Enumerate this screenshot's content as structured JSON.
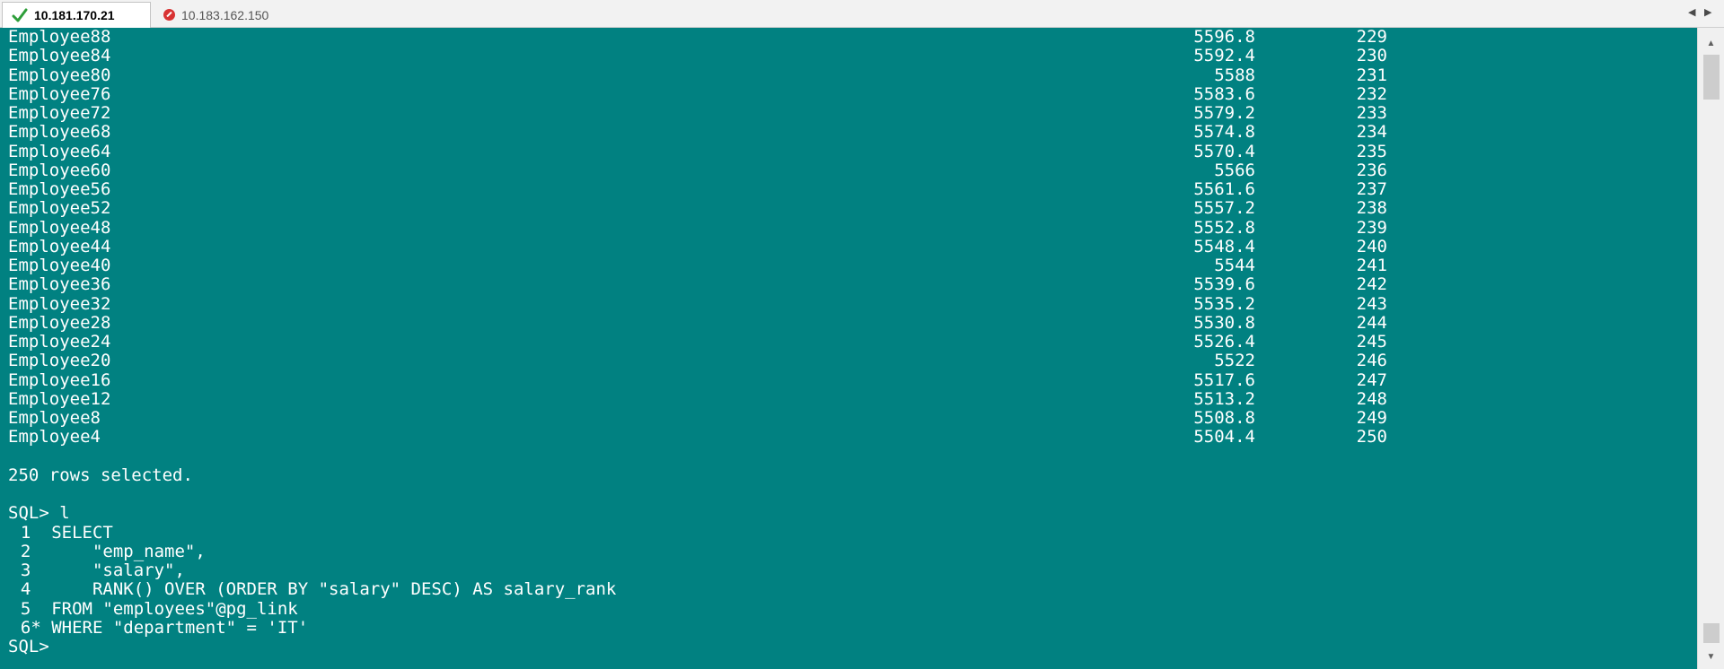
{
  "tabs": [
    {
      "label": "10.181.170.21",
      "status": "connected"
    },
    {
      "label": "10.183.162.150",
      "status": "disconnected"
    }
  ],
  "colors": {
    "terminal_bg": "#018181",
    "terminal_text": "#ffffff",
    "tab_bar": "#f2f2f2"
  },
  "icons": {
    "active_tab": "check-icon",
    "inactive_tab": "disconnected-icon"
  },
  "rows": [
    {
      "name": "Employee88",
      "salary": "5596.8",
      "rank": "229"
    },
    {
      "name": "Employee84",
      "salary": "5592.4",
      "rank": "230"
    },
    {
      "name": "Employee80",
      "salary": "5588",
      "rank": "231"
    },
    {
      "name": "Employee76",
      "salary": "5583.6",
      "rank": "232"
    },
    {
      "name": "Employee72",
      "salary": "5579.2",
      "rank": "233"
    },
    {
      "name": "Employee68",
      "salary": "5574.8",
      "rank": "234"
    },
    {
      "name": "Employee64",
      "salary": "5570.4",
      "rank": "235"
    },
    {
      "name": "Employee60",
      "salary": "5566",
      "rank": "236"
    },
    {
      "name": "Employee56",
      "salary": "5561.6",
      "rank": "237"
    },
    {
      "name": "Employee52",
      "salary": "5557.2",
      "rank": "238"
    },
    {
      "name": "Employee48",
      "salary": "5552.8",
      "rank": "239"
    },
    {
      "name": "Employee44",
      "salary": "5548.4",
      "rank": "240"
    },
    {
      "name": "Employee40",
      "salary": "5544",
      "rank": "241"
    },
    {
      "name": "Employee36",
      "salary": "5539.6",
      "rank": "242"
    },
    {
      "name": "Employee32",
      "salary": "5535.2",
      "rank": "243"
    },
    {
      "name": "Employee28",
      "salary": "5530.8",
      "rank": "244"
    },
    {
      "name": "Employee24",
      "salary": "5526.4",
      "rank": "245"
    },
    {
      "name": "Employee20",
      "salary": "5522",
      "rank": "246"
    },
    {
      "name": "Employee16",
      "salary": "5517.6",
      "rank": "247"
    },
    {
      "name": "Employee12",
      "salary": "5513.2",
      "rank": "248"
    },
    {
      "name": "Employee8",
      "salary": "5508.8",
      "rank": "249"
    },
    {
      "name": "Employee4",
      "salary": "5504.4",
      "rank": "250"
    }
  ],
  "summary": "250 rows selected.",
  "command": "SQL> l",
  "sql_lines": [
    "  1  SELECT",
    "  2      \"emp_name\",",
    "  3      \"salary\",",
    "  4      RANK() OVER (ORDER BY \"salary\" DESC) AS salary_rank",
    "  5  FROM \"employees\"@pg_link",
    "  6* WHERE \"department\" = 'IT'"
  ],
  "prompt": "SQL>"
}
